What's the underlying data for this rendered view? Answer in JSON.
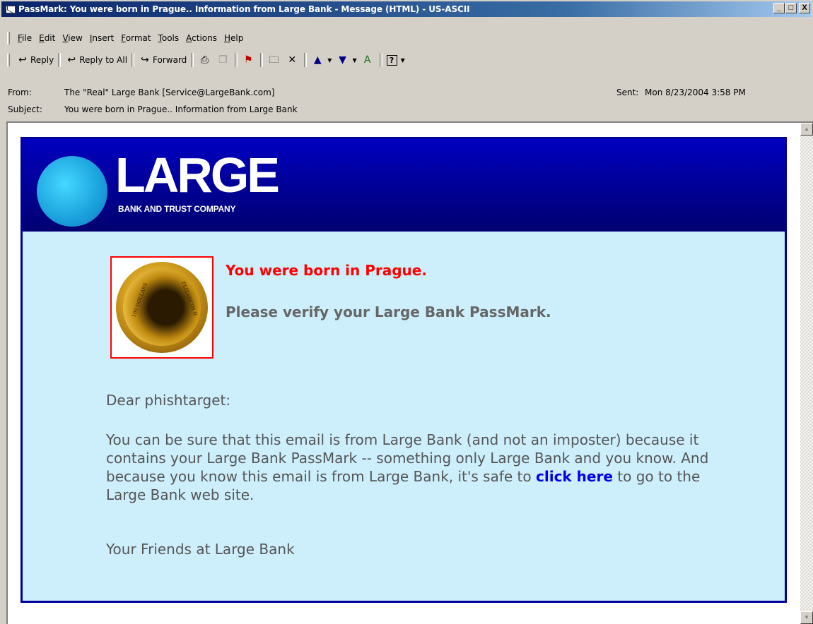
{
  "window": {
    "title": "PassMark: You were born in Prague..  Information from Large Bank - Message (HTML)  - US-ASCII",
    "controls": [
      "_",
      "□",
      "X"
    ]
  },
  "menu": [
    "File",
    "Edit",
    "View",
    "Insert",
    "Format",
    "Tools",
    "Actions",
    "Help"
  ],
  "toolbar": {
    "reply": "Reply",
    "reply_all": "Reply to All",
    "forward": "Forward"
  },
  "header": {
    "from_label": "From:",
    "from_value": "The \"Real\" Large Bank [Service@LargeBank.com]",
    "subject_label": "Subject:",
    "subject_value": "You were born in Prague..  Information from Large Bank",
    "sent_label": "Sent:",
    "sent_value": "Mon 8/23/2004 3:58 PM"
  },
  "email": {
    "logo_main": "LARGE",
    "logo_sub": "BANK AND TRUST COMPANY",
    "coin_left": "100 DOLLARS",
    "coin_right": "ELIZABETH II",
    "born": "You were born in Prague.",
    "verify": "Please verify your Large Bank PassMark.",
    "greeting": "Dear phishtarget:",
    "body_before": "You can be sure that this email is from Large Bank (and not an imposter) because it contains your Large Bank PassMark -- something only Large Bank and you know. And because you know this email is from Large Bank, it's safe to",
    "link": "click here",
    "body_after": "to go to the Large Bank web site.",
    "signoff": "Your Friends at Large Bank"
  },
  "colors": {
    "banner": "#00009a",
    "body_bg": "#cdeefb",
    "born_text": "#ff0000",
    "link": "#0000ee"
  }
}
